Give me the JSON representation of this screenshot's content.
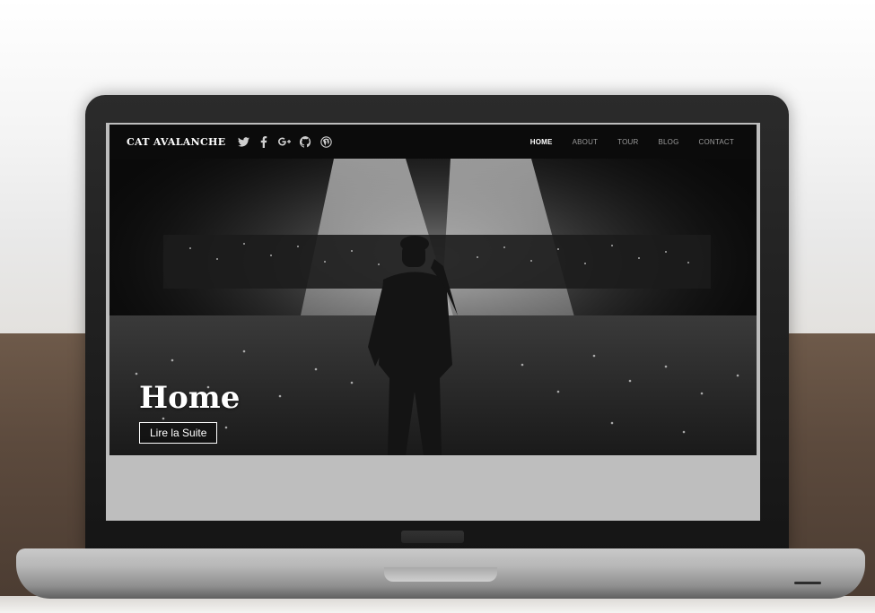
{
  "site": {
    "brand": "CAT AVALANCHE",
    "social_icons": [
      "twitter-icon",
      "facebook-icon",
      "google-plus-icon",
      "github-icon",
      "wordpress-icon"
    ],
    "nav": [
      {
        "label": "HOME",
        "active": true
      },
      {
        "label": "ABOUT",
        "active": false
      },
      {
        "label": "TOUR",
        "active": false
      },
      {
        "label": "BLOG",
        "active": false
      },
      {
        "label": "CONTACT",
        "active": false
      }
    ]
  },
  "hero": {
    "title": "Home",
    "button_label": "Lire la Suite"
  },
  "colors": {
    "navbar_bg": "#0b0b0b",
    "nav_active": "#ffffff",
    "nav_inactive": "#9a9a9a",
    "laptop_bezel": "#1c1c1c",
    "desk": "#5c4a3d"
  }
}
